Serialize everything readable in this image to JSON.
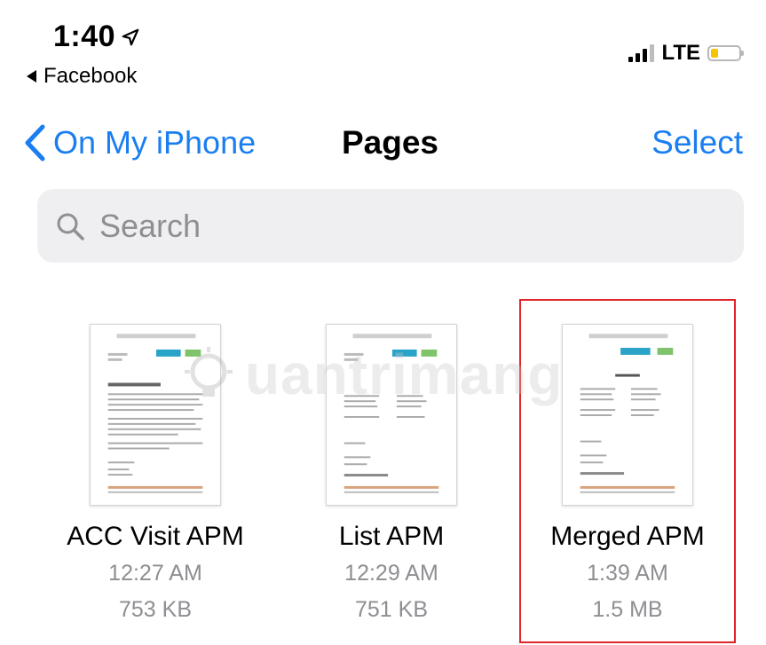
{
  "status": {
    "time": "1:40",
    "back_app": "Facebook",
    "network": "LTE",
    "battery_color": "#f5c400"
  },
  "nav": {
    "back_label": "On My iPhone",
    "title": "Pages",
    "select_label": "Select",
    "accent": "#1a7ef0"
  },
  "search": {
    "placeholder": "Search",
    "icon": "search-icon"
  },
  "files": [
    {
      "name": "ACC Visit APM",
      "time": "12:27 AM",
      "size": "753 KB"
    },
    {
      "name": "List APM",
      "time": "12:29 AM",
      "size": "751 KB"
    },
    {
      "name": "Merged APM",
      "time": "1:39 AM",
      "size": "1.5 MB"
    }
  ],
  "highlight_color": "#e0242a",
  "watermark": "uantrimang"
}
